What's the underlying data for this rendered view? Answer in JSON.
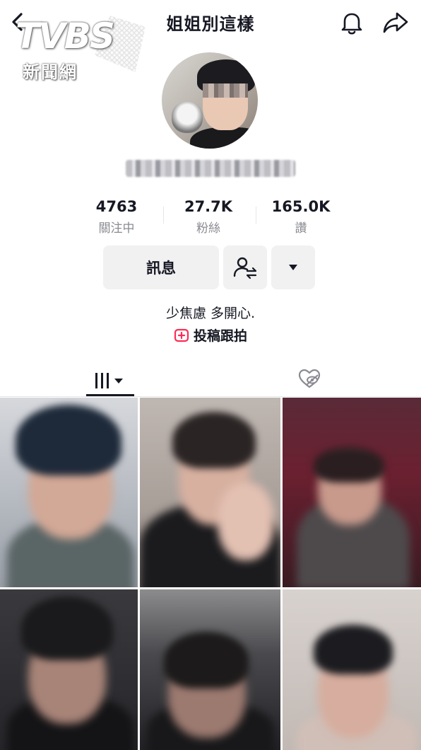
{
  "header": {
    "title": "姐姐別這樣",
    "icons": [
      "chevron-left-icon",
      "bell-icon",
      "share-icon"
    ]
  },
  "watermark": {
    "brand": "TVBS",
    "sub": "新聞網"
  },
  "stats": [
    {
      "value": "4763",
      "label": "關注中"
    },
    {
      "value": "27.7K",
      "label": "粉絲"
    },
    {
      "value": "165.0K",
      "label": "讚"
    }
  ],
  "actions": {
    "message_label": "訊息"
  },
  "bio": {
    "text": "少焦慮 多開心.",
    "link_label": "投稿跟拍"
  },
  "colors": {
    "accent": "#fe2c55",
    "text": "#161823",
    "muted": "#8a8b91",
    "button_bg": "#f1f1f2"
  }
}
